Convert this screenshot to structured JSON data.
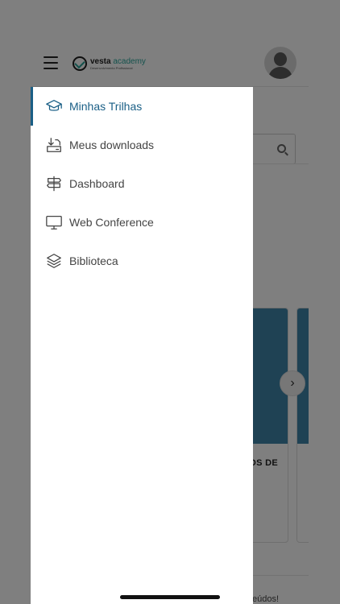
{
  "app": {
    "logo": {
      "name_main": "vesta",
      "name_accent": " academy",
      "tagline": "Desenvolvimento Profissional"
    },
    "card": {
      "title_partial": "OS DE"
    },
    "bottom_text_partial": "teúdos!"
  },
  "drawer": {
    "items": [
      {
        "label": "Minhas Trilhas",
        "icon": "graduation-cap-icon",
        "active": true
      },
      {
        "label": "Meus downloads",
        "icon": "download-icon",
        "active": false
      },
      {
        "label": "Dashboard",
        "icon": "signpost-icon",
        "active": false
      },
      {
        "label": "Web Conference",
        "icon": "monitor-icon",
        "active": false
      },
      {
        "label": "Biblioteca",
        "icon": "layers-icon",
        "active": false
      }
    ]
  },
  "colors": {
    "accent": "#1a5f86",
    "card_image": "#3e84a8",
    "overlay": "rgba(0,0,0,0.5)"
  }
}
